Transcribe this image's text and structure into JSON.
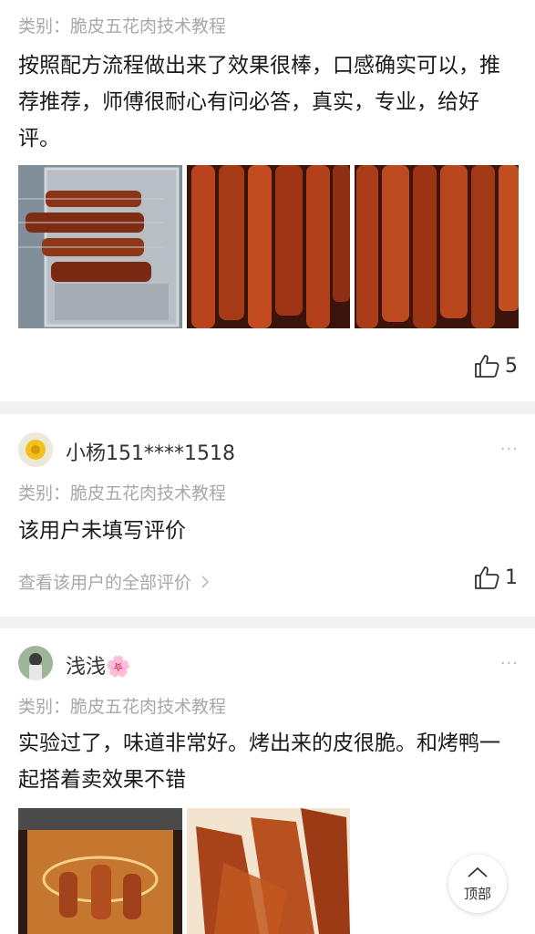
{
  "reviews": [
    {
      "category": "类别：脆皮五花肉技术教程",
      "text": "按照配方流程做出来了效果很棒，口感确实可以，推荐推荐，师傅很耐心有问必答，真实，专业，给好评。",
      "likes": "5"
    },
    {
      "username": "小杨151****1518",
      "more": "···",
      "category": "类别：脆皮五花肉技术教程",
      "text": "该用户未填写评价",
      "view_all": "查看该用户的全部评价",
      "likes": "1"
    },
    {
      "username": "浅浅🌸",
      "more": "···",
      "category": "类别：脆皮五花肉技术教程",
      "text": "实验过了，味道非常好。烤出来的皮很脆。和烤鸭一起搭着卖效果不错"
    }
  ],
  "back_to_top": {
    "label": "顶部"
  },
  "colors": {
    "accent_meat": "#9b2f14",
    "background": "#f2f2f2"
  }
}
